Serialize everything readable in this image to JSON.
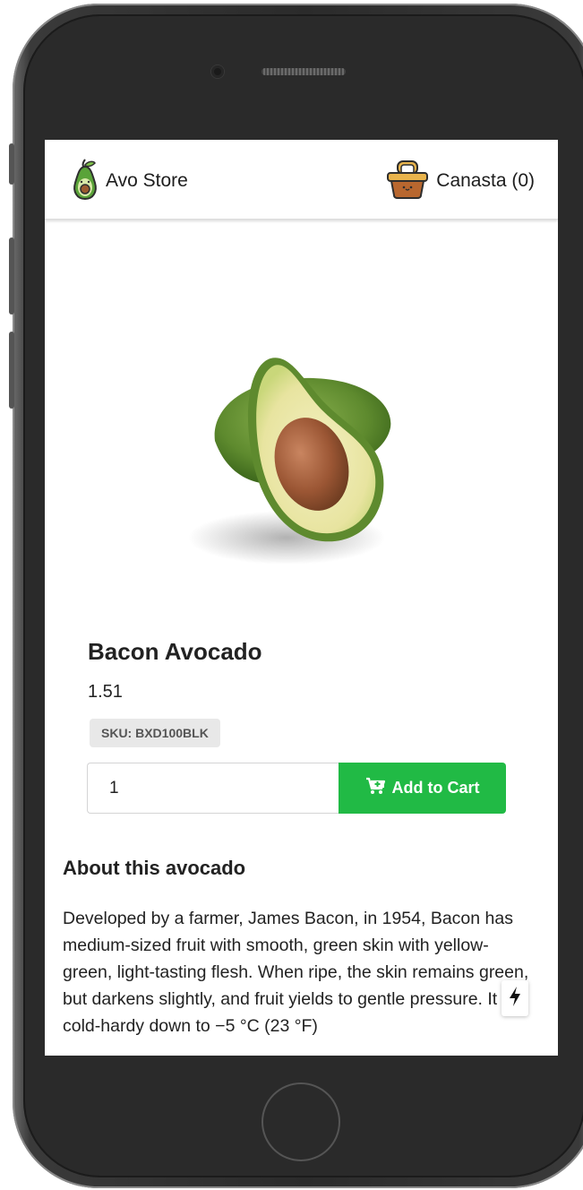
{
  "navbar": {
    "brand_label": "Avo Store",
    "brand_icon": "avocado-logo-icon",
    "cart_label": "Canasta (0)",
    "cart_icon": "basket-icon"
  },
  "product": {
    "image_icon": "avocado-half-icon",
    "name": "Bacon Avocado",
    "price": "1.51",
    "sku": "SKU: BXD100BLK",
    "quantity_value": "1",
    "add_to_cart_label": "Add to Cart",
    "add_to_cart_icon": "cart-plus-icon",
    "accent_color": "#21ba45"
  },
  "about": {
    "heading": "About this avocado",
    "description": "Developed by a farmer, James Bacon, in 1954, Bacon has medium-sized fruit with smooth, green skin with yellow-green, light-tasting flesh. When ripe, the skin remains green, but darkens slightly, and fruit yields to gentle pressure. It is cold-hardy down to −5 °C (23 °F)"
  },
  "floating": {
    "icon": "lightning-bolt-icon"
  }
}
